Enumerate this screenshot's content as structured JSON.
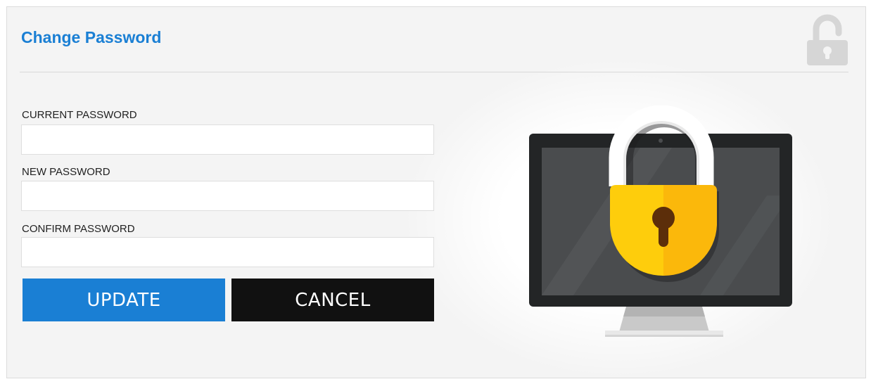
{
  "page": {
    "title": "Change Password"
  },
  "form": {
    "fields": [
      {
        "label": "CURRENT PASSWORD",
        "value": ""
      },
      {
        "label": "NEW PASSWORD",
        "value": ""
      },
      {
        "label": "CONFIRM PASSWORD",
        "value": ""
      }
    ],
    "update_label": "UPDATE",
    "cancel_label": "CANCEL"
  },
  "icons": {
    "corner": "unlocked-padlock-icon",
    "illustration": "monitor-with-padlock-illustration"
  },
  "colors": {
    "accent": "#1a7fd4",
    "cancel": "#111111",
    "lock_body_left": "#fecd0c",
    "lock_body_right": "#fbb80b",
    "monitor": "#232526"
  }
}
